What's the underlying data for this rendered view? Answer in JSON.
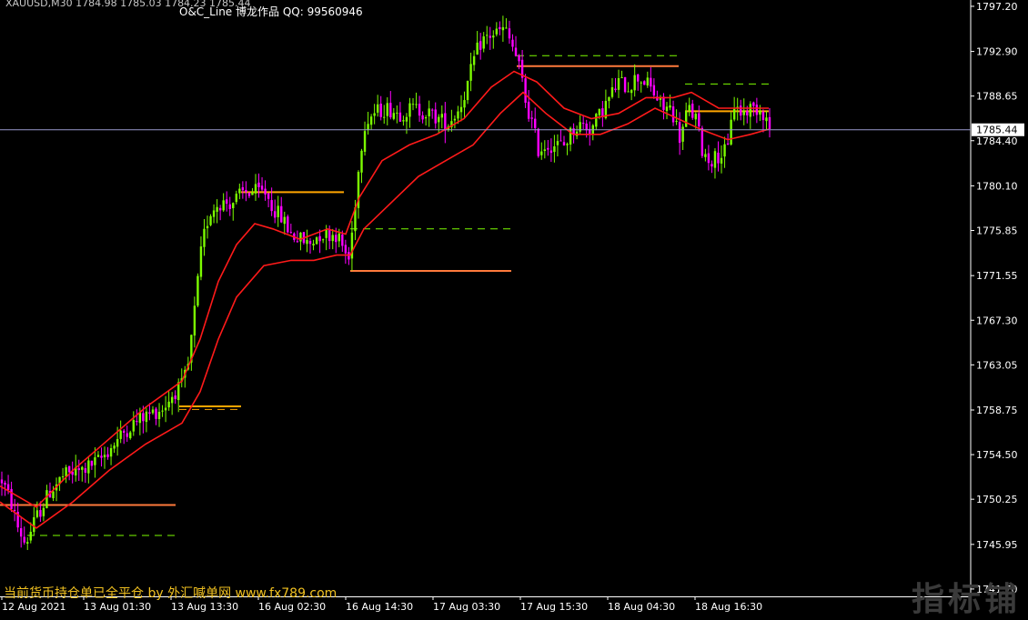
{
  "header": {
    "symbol_line": "XAUUSD,M30 1784.98 1785.03 1784.23 1785.44",
    "indicator_line": "O&C_Line   博龙作品   QQ: 99560946"
  },
  "footer_text": "当前货币持仓单已全平仓   by  外汇喊单网 www.fx789.com",
  "watermark": "指标铺",
  "colors": {
    "background": "#000000",
    "bull_candle": "#7CFC00",
    "bear_candle": "#FF00FF",
    "ma_line": "#FF1A1A",
    "oc_line_solid": "#FF7A3C",
    "oc_line_solid_alt": "#FFA500",
    "oc_line_dash": "#7CFC00",
    "axis_text": "#FFFFFF",
    "price_line": "#9999CC"
  },
  "chart_data": {
    "type": "candlestick",
    "ylim": [
      1741.0,
      1797.8
    ],
    "y_ticks": [
      "1797.20",
      "1792.90",
      "1788.65",
      "1784.40",
      "1780.10",
      "1775.85",
      "1771.55",
      "1767.30",
      "1763.05",
      "1758.75",
      "1754.50",
      "1750.25",
      "1745.95",
      "1741.70"
    ],
    "y_tick_values": [
      1797.2,
      1792.9,
      1788.65,
      1784.4,
      1780.1,
      1775.85,
      1771.55,
      1767.3,
      1763.05,
      1758.75,
      1754.5,
      1750.25,
      1745.95,
      1741.7
    ],
    "x_ticks": [
      "12 Aug 2021",
      "13 Aug 01:30",
      "13 Aug 13:30",
      "16 Aug 02:30",
      "16 Aug 14:30",
      "17 Aug 03:30",
      "17 Aug 15:30",
      "18 Aug 04:30",
      "18 Aug 16:30"
    ],
    "current_price": "1785.44",
    "current_price_value": 1785.44,
    "candle_count": 240,
    "path": [
      [
        0,
        1752.5
      ],
      [
        12,
        1750.0
      ],
      [
        20,
        1747.5
      ],
      [
        28,
        1746.0
      ],
      [
        40,
        1748.5
      ],
      [
        55,
        1751.0
      ],
      [
        70,
        1752.5
      ],
      [
        90,
        1753.0
      ],
      [
        110,
        1754.0
      ],
      [
        125,
        1755.5
      ],
      [
        140,
        1757.0
      ],
      [
        155,
        1758.0
      ],
      [
        168,
        1758.5
      ],
      [
        180,
        1759.0
      ],
      [
        192,
        1760.5
      ],
      [
        200,
        1761.0
      ],
      [
        207,
        1763.0
      ],
      [
        215,
        1769.0
      ],
      [
        222,
        1774.5
      ],
      [
        230,
        1777.5
      ],
      [
        240,
        1778.5
      ],
      [
        255,
        1778.5
      ],
      [
        268,
        1779.5
      ],
      [
        280,
        1779.5
      ],
      [
        292,
        1779.5
      ],
      [
        300,
        1778.0
      ],
      [
        310,
        1777.0
      ],
      [
        320,
        1775.5
      ],
      [
        330,
        1775.0
      ],
      [
        340,
        1774.5
      ],
      [
        350,
        1775.5
      ],
      [
        360,
        1775.5
      ],
      [
        370,
        1775.5
      ],
      [
        378,
        1774.0
      ],
      [
        384,
        1773.0
      ],
      [
        392,
        1780.0
      ],
      [
        400,
        1786.0
      ],
      [
        410,
        1787.0
      ],
      [
        425,
        1787.5
      ],
      [
        440,
        1787.0
      ],
      [
        455,
        1787.5
      ],
      [
        470,
        1787.0
      ],
      [
        482,
        1786.5
      ],
      [
        492,
        1786.0
      ],
      [
        505,
        1787.5
      ],
      [
        515,
        1790.0
      ],
      [
        522,
        1792.5
      ],
      [
        530,
        1794.0
      ],
      [
        540,
        1794.5
      ],
      [
        555,
        1795.0
      ],
      [
        565,
        1793.0
      ],
      [
        572,
        1791.0
      ],
      [
        578,
        1788.0
      ],
      [
        585,
        1786.0
      ],
      [
        592,
        1783.5
      ],
      [
        600,
        1784.0
      ],
      [
        610,
        1784.0
      ],
      [
        620,
        1784.0
      ],
      [
        630,
        1785.5
      ],
      [
        640,
        1786.0
      ],
      [
        650,
        1785.5
      ],
      [
        660,
        1787.0
      ],
      [
        670,
        1788.5
      ],
      [
        680,
        1790.0
      ],
      [
        690,
        1789.5
      ],
      [
        700,
        1790.5
      ],
      [
        710,
        1790.0
      ],
      [
        718,
        1789.0
      ],
      [
        728,
        1787.5
      ],
      [
        738,
        1787.5
      ],
      [
        748,
        1784.5
      ],
      [
        756,
        1787.5
      ],
      [
        765,
        1786.5
      ],
      [
        772,
        1783.5
      ],
      [
        780,
        1782.5
      ],
      [
        790,
        1783.0
      ],
      [
        800,
        1783.5
      ],
      [
        805,
        1788.0
      ],
      [
        815,
        1787.0
      ],
      [
        825,
        1787.5
      ],
      [
        835,
        1787.5
      ],
      [
        840,
        1787.0
      ],
      [
        847,
        1785.3
      ]
    ],
    "ma_fast": [
      [
        0,
        1751.5
      ],
      [
        40,
        1749.5
      ],
      [
        80,
        1753.0
      ],
      [
        120,
        1756.0
      ],
      [
        160,
        1759.0
      ],
      [
        200,
        1761.5
      ],
      [
        220,
        1765.5
      ],
      [
        240,
        1771.0
      ],
      [
        260,
        1774.5
      ],
      [
        280,
        1776.5
      ],
      [
        300,
        1776.0
      ],
      [
        330,
        1775.0
      ],
      [
        360,
        1776.0
      ],
      [
        380,
        1775.5
      ],
      [
        395,
        1779.0
      ],
      [
        420,
        1782.5
      ],
      [
        450,
        1784.0
      ],
      [
        480,
        1785.0
      ],
      [
        510,
        1786.5
      ],
      [
        540,
        1789.5
      ],
      [
        565,
        1791.0
      ],
      [
        590,
        1790.0
      ],
      [
        620,
        1787.5
      ],
      [
        650,
        1786.5
      ],
      [
        680,
        1787.0
      ],
      [
        710,
        1788.5
      ],
      [
        740,
        1788.5
      ],
      [
        760,
        1789.0
      ],
      [
        790,
        1787.5
      ],
      [
        820,
        1787.5
      ],
      [
        845,
        1787.5
      ]
    ],
    "ma_slow": [
      [
        0,
        1750.0
      ],
      [
        40,
        1747.5
      ],
      [
        80,
        1750.0
      ],
      [
        120,
        1753.0
      ],
      [
        160,
        1755.5
      ],
      [
        200,
        1757.5
      ],
      [
        220,
        1760.5
      ],
      [
        240,
        1765.5
      ],
      [
        260,
        1769.5
      ],
      [
        290,
        1772.5
      ],
      [
        320,
        1773.0
      ],
      [
        345,
        1773.0
      ],
      [
        370,
        1773.5
      ],
      [
        385,
        1773.5
      ],
      [
        400,
        1776.0
      ],
      [
        430,
        1778.5
      ],
      [
        460,
        1781.0
      ],
      [
        490,
        1782.5
      ],
      [
        520,
        1784.0
      ],
      [
        550,
        1787.0
      ],
      [
        575,
        1789.0
      ],
      [
        600,
        1787.0
      ],
      [
        630,
        1785.0
      ],
      [
        660,
        1785.0
      ],
      [
        690,
        1786.0
      ],
      [
        720,
        1787.5
      ],
      [
        745,
        1786.5
      ],
      [
        770,
        1785.5
      ],
      [
        800,
        1784.5
      ],
      [
        825,
        1785.0
      ],
      [
        845,
        1785.5
      ]
    ],
    "oc_segments": [
      {
        "x1": 0,
        "x2": 193,
        "y": 1749.7,
        "style": "solid"
      },
      {
        "x1": 30,
        "x2": 193,
        "y": 1746.8,
        "style": "dash"
      },
      {
        "x1": 197,
        "x2": 265,
        "y": 1759.1,
        "style": "solid_alt"
      },
      {
        "x1": 197,
        "x2": 265,
        "y": 1758.8,
        "style": "dash_alt"
      },
      {
        "x1": 265,
        "x2": 378,
        "y": 1779.5,
        "style": "solid_alt"
      },
      {
        "x1": 385,
        "x2": 562,
        "y": 1776.0,
        "style": "dash"
      },
      {
        "x1": 385,
        "x2": 562,
        "y": 1772.0,
        "style": "solid"
      },
      {
        "x1": 568,
        "x2": 746,
        "y": 1792.5,
        "style": "dash"
      },
      {
        "x1": 568,
        "x2": 746,
        "y": 1791.5,
        "style": "solid"
      },
      {
        "x1": 753,
        "x2": 845,
        "y": 1789.8,
        "style": "dash"
      },
      {
        "x1": 753,
        "x2": 845,
        "y": 1787.2,
        "style": "solid_alt"
      }
    ]
  }
}
